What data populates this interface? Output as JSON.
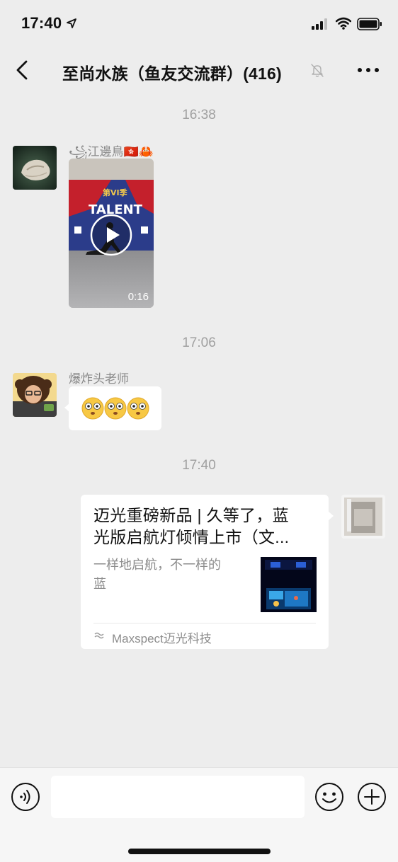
{
  "status_bar": {
    "time": "17:40",
    "icons": [
      "location-arrow-icon",
      "cellular-signal-icon",
      "wifi-icon",
      "battery-icon"
    ]
  },
  "nav": {
    "title": "至尚水族（鱼友交流群）(416)",
    "icons": [
      "back-icon",
      "mute-bell-icon",
      "more-icon"
    ]
  },
  "messages": [
    {
      "timestamp": "16:38",
      "sender": "꧁江邊鳥🇭🇰🦀",
      "type": "video",
      "duration": "0:16",
      "video_signage": "TALENT"
    },
    {
      "timestamp": "17:06",
      "sender": "爆炸头老师",
      "type": "emoji",
      "emoji": "😳😳😳"
    },
    {
      "timestamp": "17:40",
      "sender": "",
      "type": "link",
      "link_title": "迈光重磅新品 | 久等了，蓝\n光版启航灯倾情上市（文...",
      "link_desc": "一样地启航，不一样的\n蓝",
      "link_source": "Maxspect迈光科技"
    }
  ],
  "input_bar": {
    "placeholder": "",
    "icons": [
      "voice-icon",
      "emoji-icon",
      "plus-icon"
    ]
  },
  "colors": {
    "background": "#ededed",
    "bubble": "#ffffff",
    "timestamp": "#a0a0a0",
    "sender": "#8a8a8a"
  }
}
